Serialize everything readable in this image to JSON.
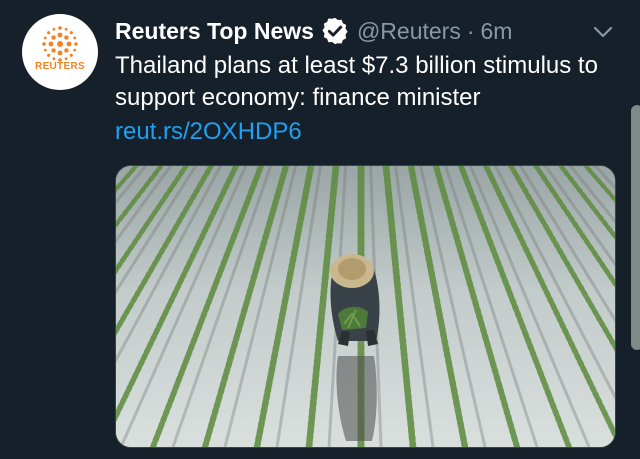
{
  "tweet": {
    "display_name": "Reuters Top News",
    "handle": "@Reuters",
    "separator": "·",
    "time": "6m",
    "text": "Thailand plans at least $7.3 billion stimulus to support economy: finance minister",
    "link": "reut.rs/2OXHDP6"
  },
  "avatar": {
    "label": "REUTERS",
    "brand_color": "#f58220"
  },
  "icons": {
    "verified": "verified-badge-icon",
    "menu": "chevron-down-icon"
  },
  "media": {
    "description_icon": "photo-rice-field",
    "accent": "#15202b"
  }
}
